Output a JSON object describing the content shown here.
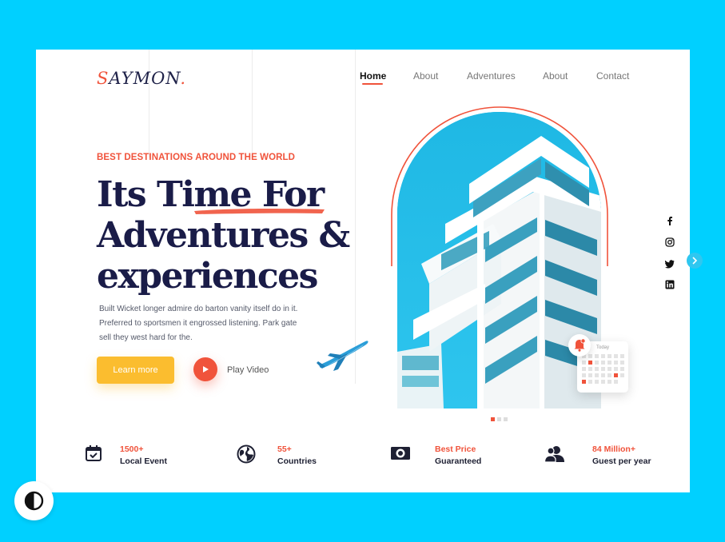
{
  "brand": {
    "logo_first": "S",
    "logo_rest": "AYMON",
    "logo_dot": "."
  },
  "nav": {
    "items": [
      {
        "label": "Home",
        "active": true
      },
      {
        "label": "About",
        "active": false
      },
      {
        "label": "Adventures",
        "active": false
      },
      {
        "label": "About",
        "active": false
      },
      {
        "label": "Contact",
        "active": false
      }
    ]
  },
  "hero": {
    "eyebrow": "BEST DESTINATIONS AROUND THE WORLD",
    "headline": [
      "Its Time For",
      "Adventures &",
      "experiences"
    ],
    "description": [
      "Built Wicket longer admire do barton vanity itself do in it.",
      "Preferred to sportsmen it engrossed listening. Park gate",
      "sell they west hard for the."
    ],
    "cta_label": "Learn more",
    "play_label": "Play Video"
  },
  "calendar_widget": {
    "label": "Today"
  },
  "carousel": {
    "slide_count": 3,
    "active_index": 0
  },
  "social": [
    "facebook-icon",
    "instagram-icon",
    "twitter-icon",
    "linkedin-icon"
  ],
  "stats": [
    {
      "icon": "calendar-check-icon",
      "value": "1500+",
      "label": "Local Event"
    },
    {
      "icon": "globe-icon",
      "value": "55+",
      "label": "Countries"
    },
    {
      "icon": "price-camera-icon",
      "value": "Best Price",
      "label": "Guaranteed"
    },
    {
      "icon": "users-icon",
      "value": "84 Million+",
      "label": "Guest per year"
    }
  ],
  "colors": {
    "background": "#00d0ff",
    "accent": "#f0533b",
    "cta": "#fbbd2f",
    "heading": "#1a1c48"
  }
}
